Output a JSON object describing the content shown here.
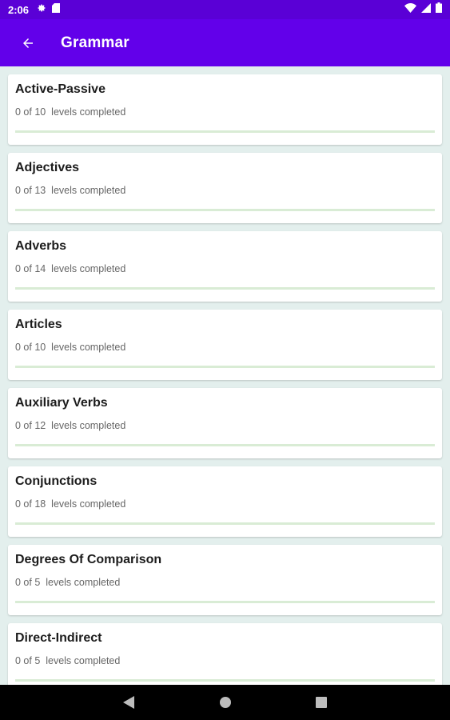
{
  "status_bar": {
    "time": "2:06",
    "icons": [
      "gear-icon",
      "sd-card-icon",
      "wifi-icon",
      "signal-icon",
      "battery-icon"
    ]
  },
  "app_bar": {
    "title": "Grammar",
    "back_icon": "back-arrow-icon",
    "color": "#6200ea"
  },
  "topics": [
    {
      "title": "Active-Passive",
      "progress": "0 of 10  levels completed",
      "completed": 0,
      "total": 10
    },
    {
      "title": "Adjectives",
      "progress": "0 of 13  levels completed",
      "completed": 0,
      "total": 13
    },
    {
      "title": "Adverbs",
      "progress": "0 of 14  levels completed",
      "completed": 0,
      "total": 14
    },
    {
      "title": "Articles",
      "progress": "0 of 10  levels completed",
      "completed": 0,
      "total": 10
    },
    {
      "title": "Auxiliary Verbs",
      "progress": "0 of 12  levels completed",
      "completed": 0,
      "total": 12
    },
    {
      "title": "Conjunctions",
      "progress": "0 of 18  levels completed",
      "completed": 0,
      "total": 18
    },
    {
      "title": "Degrees Of Comparison",
      "progress": "0 of 5  levels completed",
      "completed": 0,
      "total": 5
    },
    {
      "title": "Direct-Indirect",
      "progress": "0 of 5  levels completed",
      "completed": 0,
      "total": 5
    }
  ],
  "nav_bar": {
    "icons": [
      "back-triangle-icon",
      "home-circle-icon",
      "recents-square-icon"
    ]
  }
}
